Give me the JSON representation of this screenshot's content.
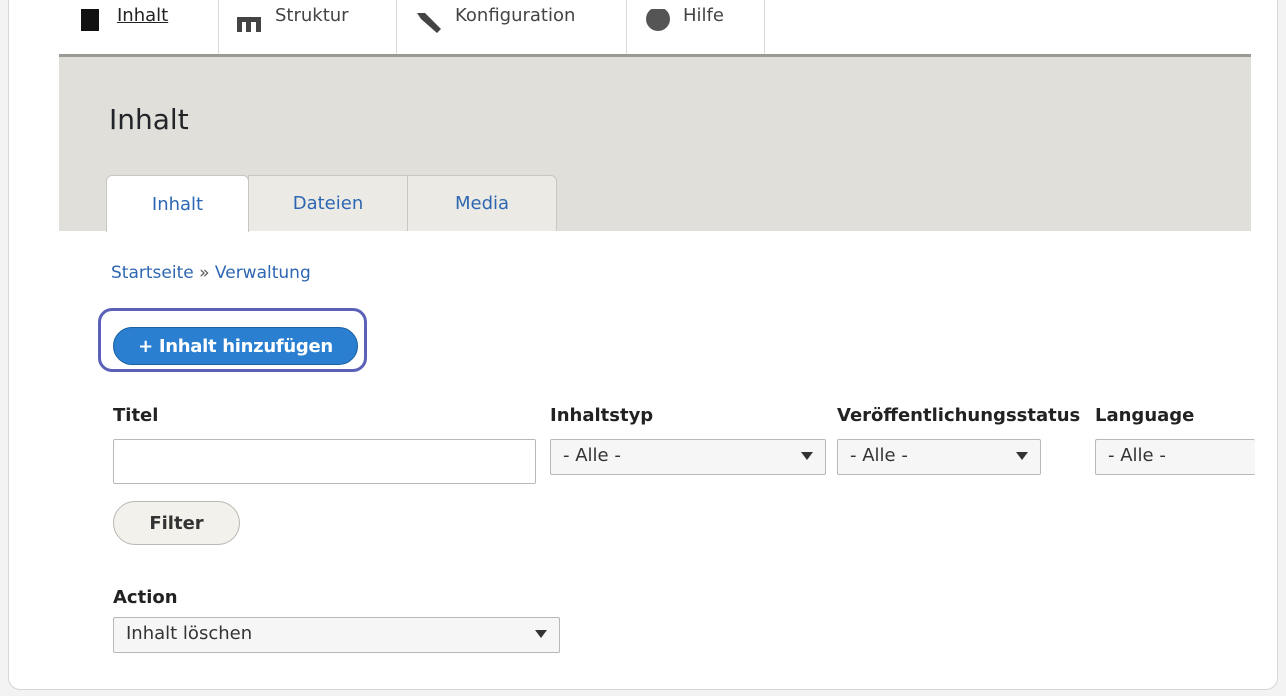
{
  "toolbar": {
    "items": [
      {
        "label": "Inhalt",
        "icon": "file-icon"
      },
      {
        "label": "Struktur",
        "icon": "sitemap-icon"
      },
      {
        "label": "Konfiguration",
        "icon": "wrench-icon"
      },
      {
        "label": "Hilfe",
        "icon": "help-icon"
      }
    ]
  },
  "header": {
    "title": "Inhalt",
    "tabs": [
      {
        "label": "Inhalt",
        "active": true
      },
      {
        "label": "Dateien",
        "active": false
      },
      {
        "label": "Media",
        "active": false
      }
    ]
  },
  "breadcrumb": {
    "home": "Startseite",
    "separator": "»",
    "current": "Verwaltung"
  },
  "actions": {
    "add_content_label": "+ Inhalt hinzufügen"
  },
  "filters": {
    "title_label": "Titel",
    "title_value": "",
    "content_type_label": "Inhaltstyp",
    "content_type_value": "- Alle -",
    "status_label": "Veröffentlichungsstatus",
    "status_value": "- Alle -",
    "language_label": "Language",
    "language_value": "- Alle -",
    "filter_button": "Filter"
  },
  "bulk": {
    "action_label": "Action",
    "action_value": "Inhalt löschen"
  },
  "colors": {
    "link": "#2d67b3",
    "primary_button": "#2a7fd0",
    "focus_ring": "#5a61b7",
    "header_bg": "#e1dfd9"
  }
}
